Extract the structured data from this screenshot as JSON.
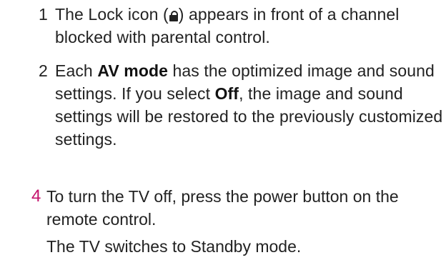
{
  "notes": [
    {
      "number": "1",
      "text_before_icon": "The Lock icon (",
      "icon": "lock-icon",
      "text_after_icon": ") appears in front of a channel blocked with parental control."
    },
    {
      "number": "2",
      "text_1": "Each ",
      "keyword_1": "AV mode",
      "text_2": " has the optimized image and sound settings. If you select ",
      "keyword_2": "Off",
      "text_3": ", the image and sound settings will be restored to the previously customized settings."
    }
  ],
  "step": {
    "number": "4",
    "number_color": "#c4126c",
    "text": "To turn the TV off, press the power button on the remote control.",
    "result": "The TV switches to Standby mode."
  }
}
